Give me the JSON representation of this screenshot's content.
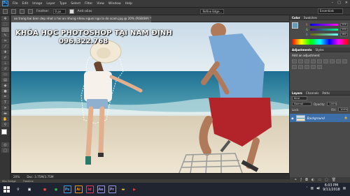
{
  "app": {
    "logo": "Ps"
  },
  "menubar": {
    "items": [
      "File",
      "Edit",
      "Image",
      "Layer",
      "Type",
      "Select",
      "Filter",
      "View",
      "Window",
      "Help"
    ]
  },
  "window_controls": {
    "minimize": "–",
    "maximize": "□",
    "close": "✕"
  },
  "options_bar": {
    "feather_label": "Feather:",
    "feather_value": "0 px",
    "antialias_label": "Anti-alias",
    "refine_label": "Refine Edge..."
  },
  "workspace": {
    "value": "Essentials"
  },
  "document": {
    "tab_title": "ao trang bai bien dep nhat o hoi an nhung nhieu nguoi ngo la do scam.jpg @ 20% (RGB/8#) *"
  },
  "overlay": {
    "title": "KHÓA HỌC PHOTOSHOP TẠI NAM ĐỊNH",
    "phone": "096.322.768"
  },
  "status": {
    "zoom": "20%",
    "doc": "Doc: 3.75M/3.75M"
  },
  "mini_bridge": {
    "tabs": [
      "Mini Bridge",
      "Timeline"
    ]
  },
  "panels": {
    "color_tabs": [
      "Color",
      "Swatches"
    ],
    "color_values": [
      "104",
      "154",
      "182"
    ],
    "adjustments_tabs": [
      "Adjustments",
      "Styles"
    ],
    "adjustments_title": "Add an adjustment",
    "layers_tabs": [
      "Layers",
      "Channels",
      "Paths"
    ],
    "kind_label": "Kind",
    "blend_mode": "Normal",
    "opacity_label": "Opacity:",
    "opacity_value": "100%",
    "lock_label": "Lock:",
    "fill_label": "Fill:",
    "fill_value": "100%",
    "layer_name": "Background"
  },
  "taskbar": {
    "apps": [
      {
        "name": "chrome",
        "glyph": "●",
        "color": "#e8453c"
      },
      {
        "name": "coccoc",
        "glyph": "●",
        "color": "#2fa84f"
      },
      {
        "name": "photoshop",
        "glyph": "Ps",
        "color": "#31a8ff"
      },
      {
        "name": "illustrator",
        "glyph": "Ai",
        "color": "#ff9a00"
      },
      {
        "name": "indesign",
        "glyph": "Id",
        "color": "#ff3366"
      },
      {
        "name": "aftereffects",
        "glyph": "Ae",
        "color": "#9999ff"
      },
      {
        "name": "premiere",
        "glyph": "Pr",
        "color": "#9999ff"
      },
      {
        "name": "explorer",
        "glyph": "▬",
        "color": "#f2c037"
      },
      {
        "name": "flash",
        "glyph": "▶",
        "color": "#e8453c"
      }
    ],
    "time": "6:03 PM",
    "date": "9/11/2018"
  }
}
